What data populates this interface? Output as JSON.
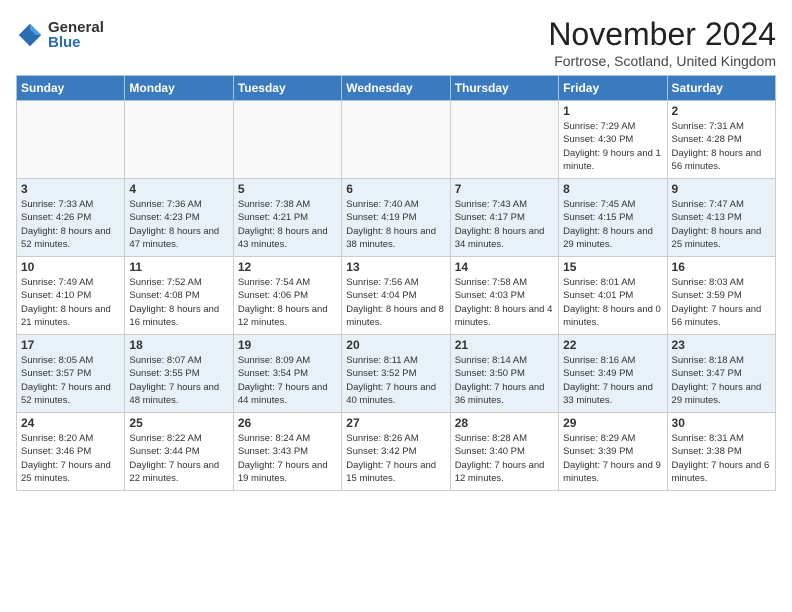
{
  "header": {
    "logo_general": "General",
    "logo_blue": "Blue",
    "title": "November 2024",
    "location": "Fortrose, Scotland, United Kingdom"
  },
  "days_of_week": [
    "Sunday",
    "Monday",
    "Tuesday",
    "Wednesday",
    "Thursday",
    "Friday",
    "Saturday"
  ],
  "weeks": [
    {
      "days": [
        {
          "num": "",
          "info": ""
        },
        {
          "num": "",
          "info": ""
        },
        {
          "num": "",
          "info": ""
        },
        {
          "num": "",
          "info": ""
        },
        {
          "num": "",
          "info": ""
        },
        {
          "num": "1",
          "info": "Sunrise: 7:29 AM\nSunset: 4:30 PM\nDaylight: 9 hours and 1 minute."
        },
        {
          "num": "2",
          "info": "Sunrise: 7:31 AM\nSunset: 4:28 PM\nDaylight: 8 hours and 56 minutes."
        }
      ]
    },
    {
      "days": [
        {
          "num": "3",
          "info": "Sunrise: 7:33 AM\nSunset: 4:26 PM\nDaylight: 8 hours and 52 minutes."
        },
        {
          "num": "4",
          "info": "Sunrise: 7:36 AM\nSunset: 4:23 PM\nDaylight: 8 hours and 47 minutes."
        },
        {
          "num": "5",
          "info": "Sunrise: 7:38 AM\nSunset: 4:21 PM\nDaylight: 8 hours and 43 minutes."
        },
        {
          "num": "6",
          "info": "Sunrise: 7:40 AM\nSunset: 4:19 PM\nDaylight: 8 hours and 38 minutes."
        },
        {
          "num": "7",
          "info": "Sunrise: 7:43 AM\nSunset: 4:17 PM\nDaylight: 8 hours and 34 minutes."
        },
        {
          "num": "8",
          "info": "Sunrise: 7:45 AM\nSunset: 4:15 PM\nDaylight: 8 hours and 29 minutes."
        },
        {
          "num": "9",
          "info": "Sunrise: 7:47 AM\nSunset: 4:13 PM\nDaylight: 8 hours and 25 minutes."
        }
      ]
    },
    {
      "days": [
        {
          "num": "10",
          "info": "Sunrise: 7:49 AM\nSunset: 4:10 PM\nDaylight: 8 hours and 21 minutes."
        },
        {
          "num": "11",
          "info": "Sunrise: 7:52 AM\nSunset: 4:08 PM\nDaylight: 8 hours and 16 minutes."
        },
        {
          "num": "12",
          "info": "Sunrise: 7:54 AM\nSunset: 4:06 PM\nDaylight: 8 hours and 12 minutes."
        },
        {
          "num": "13",
          "info": "Sunrise: 7:56 AM\nSunset: 4:04 PM\nDaylight: 8 hours and 8 minutes."
        },
        {
          "num": "14",
          "info": "Sunrise: 7:58 AM\nSunset: 4:03 PM\nDaylight: 8 hours and 4 minutes."
        },
        {
          "num": "15",
          "info": "Sunrise: 8:01 AM\nSunset: 4:01 PM\nDaylight: 8 hours and 0 minutes."
        },
        {
          "num": "16",
          "info": "Sunrise: 8:03 AM\nSunset: 3:59 PM\nDaylight: 7 hours and 56 minutes."
        }
      ]
    },
    {
      "days": [
        {
          "num": "17",
          "info": "Sunrise: 8:05 AM\nSunset: 3:57 PM\nDaylight: 7 hours and 52 minutes."
        },
        {
          "num": "18",
          "info": "Sunrise: 8:07 AM\nSunset: 3:55 PM\nDaylight: 7 hours and 48 minutes."
        },
        {
          "num": "19",
          "info": "Sunrise: 8:09 AM\nSunset: 3:54 PM\nDaylight: 7 hours and 44 minutes."
        },
        {
          "num": "20",
          "info": "Sunrise: 8:11 AM\nSunset: 3:52 PM\nDaylight: 7 hours and 40 minutes."
        },
        {
          "num": "21",
          "info": "Sunrise: 8:14 AM\nSunset: 3:50 PM\nDaylight: 7 hours and 36 minutes."
        },
        {
          "num": "22",
          "info": "Sunrise: 8:16 AM\nSunset: 3:49 PM\nDaylight: 7 hours and 33 minutes."
        },
        {
          "num": "23",
          "info": "Sunrise: 8:18 AM\nSunset: 3:47 PM\nDaylight: 7 hours and 29 minutes."
        }
      ]
    },
    {
      "days": [
        {
          "num": "24",
          "info": "Sunrise: 8:20 AM\nSunset: 3:46 PM\nDaylight: 7 hours and 25 minutes."
        },
        {
          "num": "25",
          "info": "Sunrise: 8:22 AM\nSunset: 3:44 PM\nDaylight: 7 hours and 22 minutes."
        },
        {
          "num": "26",
          "info": "Sunrise: 8:24 AM\nSunset: 3:43 PM\nDaylight: 7 hours and 19 minutes."
        },
        {
          "num": "27",
          "info": "Sunrise: 8:26 AM\nSunset: 3:42 PM\nDaylight: 7 hours and 15 minutes."
        },
        {
          "num": "28",
          "info": "Sunrise: 8:28 AM\nSunset: 3:40 PM\nDaylight: 7 hours and 12 minutes."
        },
        {
          "num": "29",
          "info": "Sunrise: 8:29 AM\nSunset: 3:39 PM\nDaylight: 7 hours and 9 minutes."
        },
        {
          "num": "30",
          "info": "Sunrise: 8:31 AM\nSunset: 3:38 PM\nDaylight: 7 hours and 6 minutes."
        }
      ]
    }
  ]
}
